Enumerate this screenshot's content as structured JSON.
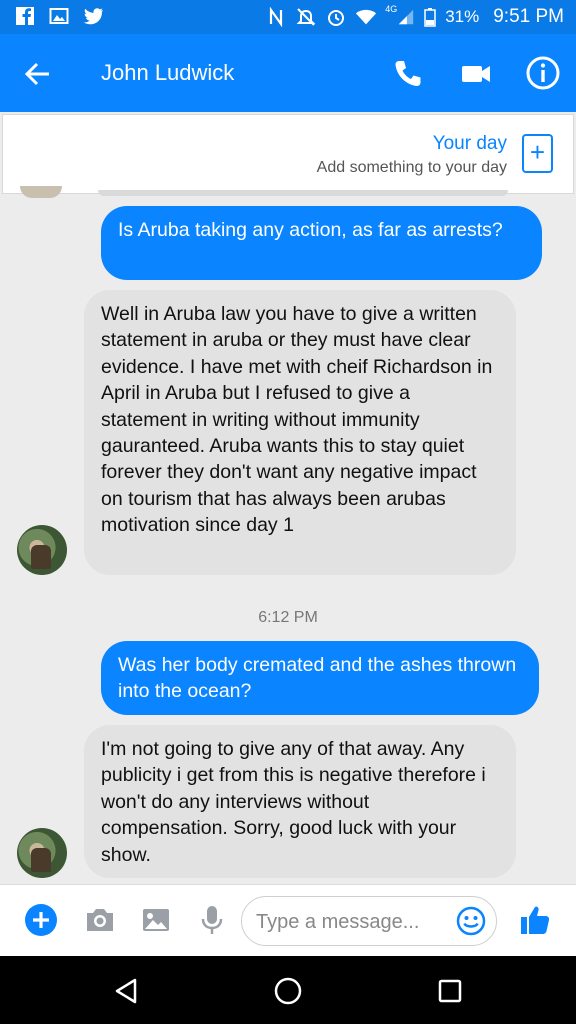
{
  "status_bar": {
    "battery": "31%",
    "time": "9:51 PM",
    "network": "4G"
  },
  "header": {
    "contact_name": "John Ludwick"
  },
  "your_day": {
    "title": "Your day",
    "subtitle": "Add something to your day",
    "add_symbol": "+"
  },
  "messages": [
    {
      "direction": "outgoing",
      "text": "Is Aruba taking any action, as far as arrests?"
    },
    {
      "direction": "incoming",
      "text": "Well in Aruba law you have to give a written statement in aruba or they must have clear evidence. I have met with cheif Richardson in April in Aruba but I refused to give a statement in writing without immunity gauranteed. Aruba wants this to stay quiet forever they don't want any negative impact on tourism that has always been arubas motivation since day 1"
    },
    {
      "direction": "outgoing",
      "text": "Was her body cremated and the ashes thrown into the ocean?"
    },
    {
      "direction": "incoming",
      "text": "I'm not going to give any of that away. Any publicity i get from this is negative therefore i won't do any interviews without compensation. Sorry, good luck with your show."
    }
  ],
  "timestamp": "6:12 PM",
  "composer": {
    "placeholder": "Type a message..."
  },
  "colors": {
    "accent": "#0a84ff",
    "incoming_bubble": "#e2e2e2",
    "status_bar": "#0a7ae6"
  },
  "icons": {
    "status_left": [
      "facebook-icon",
      "gallery-icon",
      "twitter-icon"
    ],
    "status_right": [
      "nfc-icon",
      "mute-icon",
      "alarm-icon",
      "wifi-icon",
      "signal-icon",
      "battery-icon"
    ],
    "header": [
      "back-arrow-icon",
      "phone-icon",
      "video-camera-icon",
      "info-icon"
    ],
    "composer": [
      "plus-icon",
      "camera-icon",
      "image-icon",
      "microphone-icon",
      "emoji-icon",
      "thumbs-up-icon"
    ],
    "nav": [
      "back-triangle-icon",
      "home-circle-icon",
      "recents-square-icon"
    ]
  }
}
